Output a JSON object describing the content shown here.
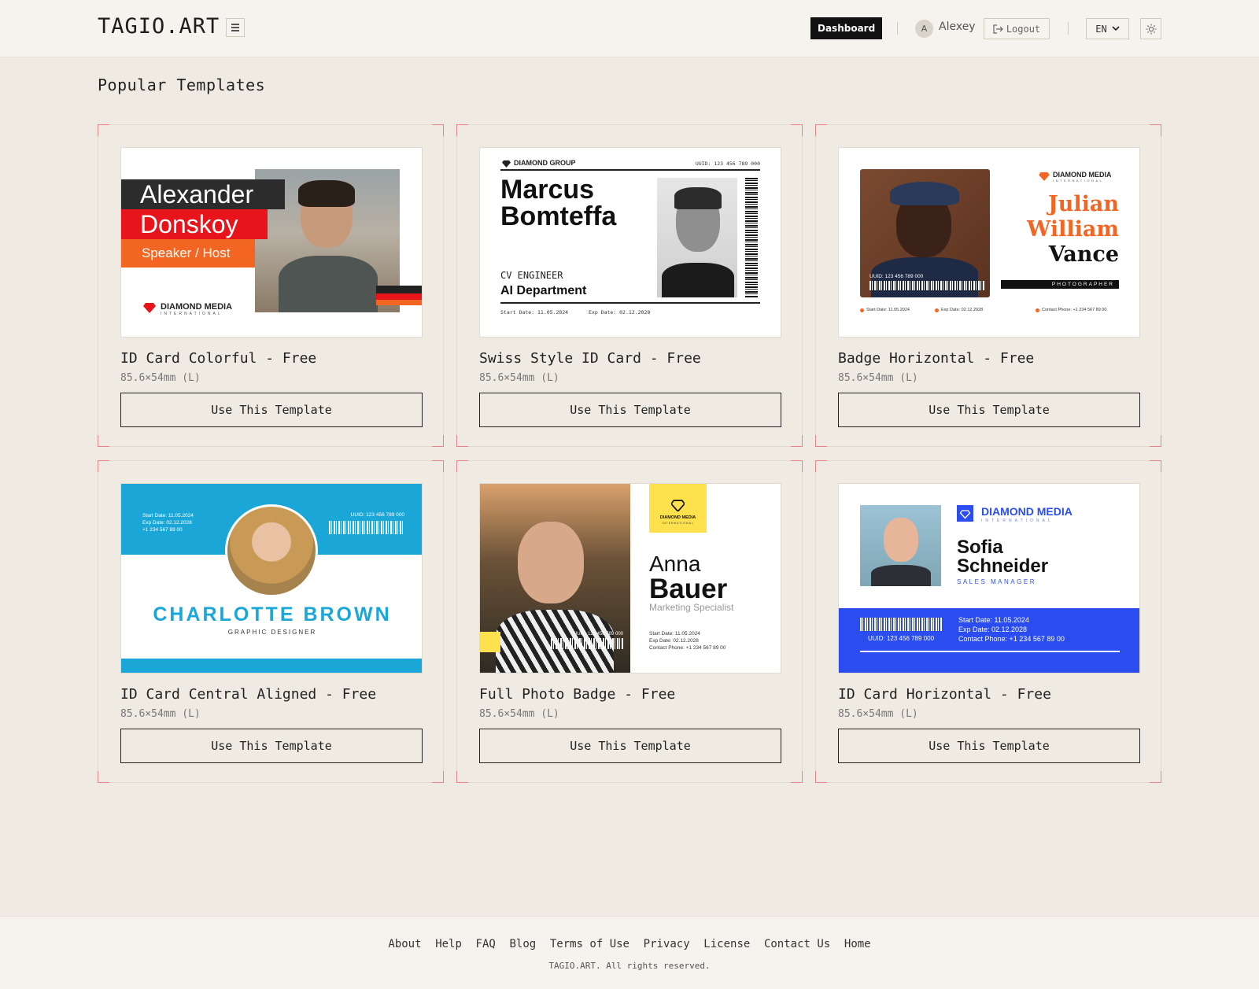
{
  "header": {
    "logo": "TAGIO.ART",
    "dashboard_label": "Dashboard",
    "avatar_initial": "A",
    "username": "Alexey",
    "logout_label": "Logout",
    "language": "EN"
  },
  "main": {
    "title": "Popular Templates",
    "templates": [
      {
        "title": "ID Card Colorful - Free",
        "size": "85.6×54mm (L)",
        "button": "Use This Template",
        "preview": {
          "first": "Alexander",
          "last": "Donskoy",
          "role": "Speaker / Host",
          "brand": "DIAMOND MEDIA",
          "brand_sub": "INTERNATIONAL"
        }
      },
      {
        "title": "Swiss Style ID Card - Free",
        "size": "85.6×54mm (L)",
        "button": "Use This Template",
        "preview": {
          "brand": "DIAMOND GROUP",
          "uuid": "UUID: 123 456 789 000",
          "first": "Marcus",
          "last": "Bomteffa",
          "role": "CV ENGINEER",
          "department": "AI Department",
          "start": "Start Date: 11.05.2024",
          "exp": "Exp Date: 02.12.2028"
        }
      },
      {
        "title": "Badge Horizontal - Free",
        "size": "85.6×54mm (L)",
        "button": "Use This Template",
        "preview": {
          "brand": "DIAMOND MEDIA",
          "brand_sub": "INTERNATIONAL",
          "first": "Julian",
          "middle": "William",
          "last": "Vance",
          "role": "PHOTOGRAPHER",
          "uuid": "UUID: 123 456 789 000",
          "start": "Start Date: 11.05.2024",
          "exp": "Exp Date: 02.12.2028",
          "phone": "Contact Phone: +1 234 567 89 00"
        }
      },
      {
        "title": "ID Card Central Aligned - Free",
        "size": "85.6×54mm (L)",
        "button": "Use This Template",
        "preview": {
          "start": "Start Date: 11.05.2024",
          "exp": "Exp Date: 02.12.2028",
          "phone": "+1 234 567 89 00",
          "uuid": "UUID: 123 456 789 000",
          "name": "CHARLOTTE BROWN",
          "role": "GRAPHIC DESIGNER"
        }
      },
      {
        "title": "Full Photo Badge - Free",
        "size": "85.6×54mm (L)",
        "button": "Use This Template",
        "preview": {
          "brand": "DIAMOND MEDIA",
          "brand_sub": "INTERNATIONAL",
          "first": "Anna",
          "last": "Bauer",
          "role": "Marketing Specialist",
          "uuid": "UUID: 123 456 789 000",
          "start": "Start Date: 11.05.2024",
          "exp": "Exp Date: 02.12.2028",
          "phone": "Contact Phone: +1 234 567 89 00"
        }
      },
      {
        "title": "ID Card Horizontal - Free",
        "size": "85.6×54mm (L)",
        "button": "Use This Template",
        "preview": {
          "brand": "DIAMOND MEDIA",
          "brand_sub": "INTERNATIONAL",
          "first": "Sofia",
          "last": "Schneider",
          "role": "SALES MANAGER",
          "uuid": "UUID: 123 456 789 000",
          "start": "Start Date: 11.05.2024",
          "exp": "Exp Date: 02.12.2028",
          "phone": "Contact Phone: +1 234 567 89 00"
        }
      }
    ]
  },
  "footer": {
    "links": [
      "About",
      "Help",
      "FAQ",
      "Blog",
      "Terms of Use",
      "Privacy",
      "License",
      "Contact Us",
      "Home"
    ],
    "copyright": "TAGIO.ART. All rights reserved."
  },
  "colors": {
    "background": "#efebe3",
    "header_bg": "#f6f3ee",
    "corner_accent": "#e8848a",
    "dashboard_bg": "#111111",
    "orange": "#f26522",
    "red": "#e8141b",
    "cyan": "#1aa7d8",
    "royal_blue": "#2b4df0",
    "yellow": "#ffe14d"
  },
  "icons": [
    "menu-icon",
    "logout-icon",
    "chevron-down-icon",
    "sun-icon",
    "diamond-icon",
    "barcode-icon",
    "portrait-photo"
  ]
}
